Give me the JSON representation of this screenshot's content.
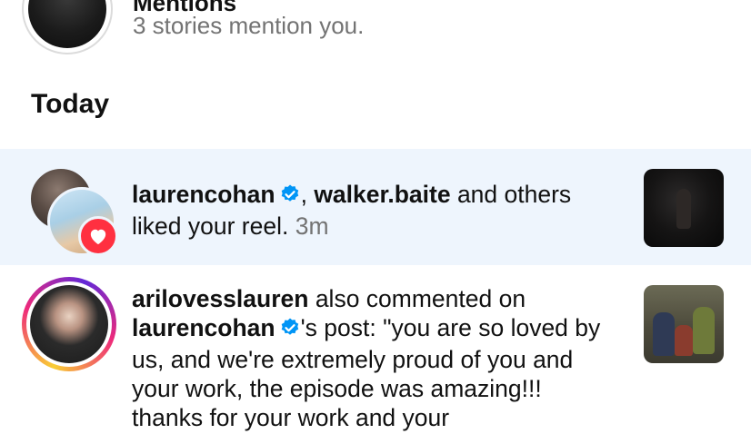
{
  "mentions": {
    "title": "Mentions",
    "subtitle": "3 stories mention you."
  },
  "section": {
    "title": "Today"
  },
  "notifications": [
    {
      "type": "like",
      "user1": "laurencohan",
      "separator": ", ",
      "user2": "walker.baite",
      "text1": " and others",
      "text2": "liked your reel.",
      "time": "3m"
    },
    {
      "type": "comment",
      "user1": "arilovesslauren",
      "text1": " also commented on",
      "user2": "laurencohan",
      "text2": "'s post: \"you are so loved by us, and we're extremely proud of you and your work, the episode was amazing!!! thanks for your work and your"
    }
  ],
  "colors": {
    "highlight_bg": "#eef5fd",
    "verified_blue": "#0095f6",
    "heart_red": "#ff3040",
    "muted_text": "#737373"
  },
  "icons": [
    "verified-badge-icon",
    "heart-icon"
  ]
}
